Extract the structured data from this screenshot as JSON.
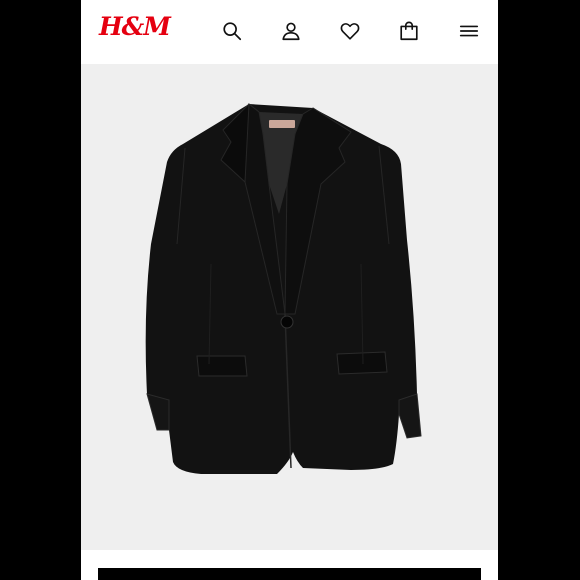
{
  "header": {
    "logo": "H&M",
    "brand_color": "#e50010",
    "icons": [
      "search-icon",
      "account-icon",
      "favorites-icon",
      "shopping-bag-icon",
      "menu-icon"
    ]
  },
  "product": {
    "image": "black-single-button-blazer",
    "background_color": "#efefef",
    "garment_color": "#121212"
  },
  "bottom": {
    "cta_color": "#000000"
  }
}
